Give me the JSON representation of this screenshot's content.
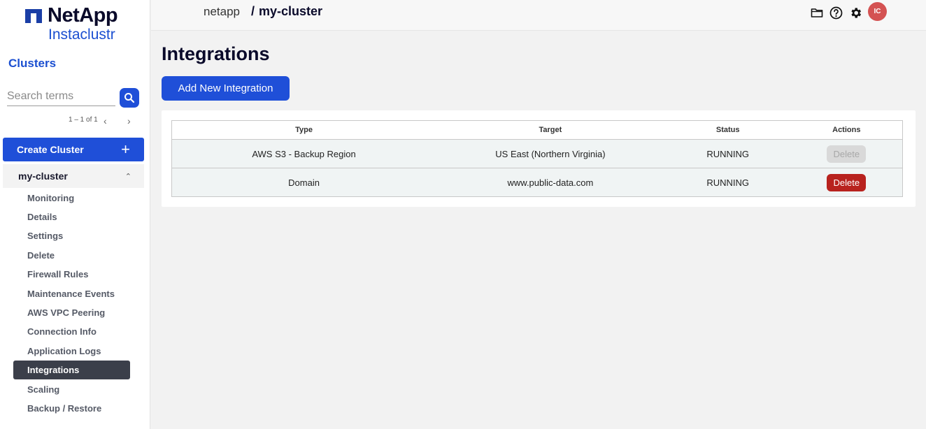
{
  "brand": {
    "name_top": "NetApp",
    "name_bottom": "Instaclustr"
  },
  "sidebar": {
    "section_title": "Clusters",
    "search": {
      "placeholder": "Search terms",
      "value": ""
    },
    "pager": {
      "text": "1 – 1 of 1",
      "prev": "‹",
      "next": "›"
    },
    "create_cluster": {
      "label": "Create Cluster",
      "plus": "+"
    },
    "cluster": {
      "name": "my-cluster",
      "chevron": "⌃"
    },
    "items": [
      {
        "label": "Monitoring"
      },
      {
        "label": "Details"
      },
      {
        "label": "Settings"
      },
      {
        "label": "Delete"
      },
      {
        "label": "Firewall Rules"
      },
      {
        "label": "Maintenance Events"
      },
      {
        "label": "AWS VPC Peering"
      },
      {
        "label": "Connection Info"
      },
      {
        "label": "Application Logs"
      },
      {
        "label": "Integrations",
        "active": true
      },
      {
        "label": "Scaling"
      },
      {
        "label": "Backup / Restore"
      }
    ]
  },
  "topbar": {
    "breadcrumb_org": "netapp",
    "breadcrumb_separator": "/",
    "breadcrumb_cluster": "my-cluster",
    "icons": [
      "folder-icon",
      "help-icon",
      "gear-icon"
    ],
    "avatar_initials": "IC"
  },
  "main": {
    "title": "Integrations",
    "add_button_label": "Add New Integration",
    "table": {
      "headers": [
        "Type",
        "Target",
        "Status",
        "Actions"
      ],
      "rows": [
        {
          "type": "AWS S3 - Backup Region",
          "target": "US East (Northern Virginia)",
          "status": "RUNNING",
          "action": "Delete",
          "action_enabled": false
        },
        {
          "type": "Domain",
          "target": "www.public-data.com",
          "status": "RUNNING",
          "action": "Delete",
          "action_enabled": true
        }
      ]
    }
  },
  "colors": {
    "primary": "#1f4fd8",
    "brand_blue": "#1b4fd1",
    "active_nav": "#3b3f4a",
    "danger": "#b8221e",
    "avatar": "#d45252"
  }
}
